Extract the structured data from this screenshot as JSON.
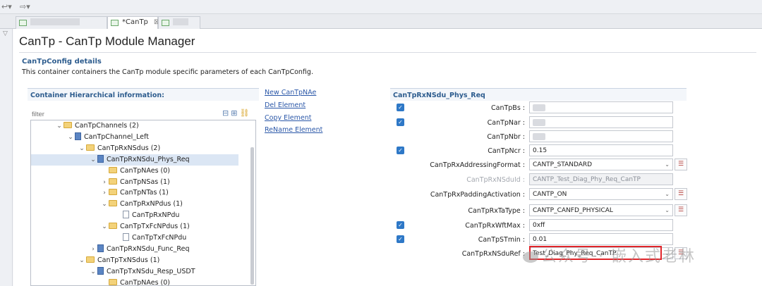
{
  "tabs": [
    {
      "label": "",
      "blurred": true
    },
    {
      "label": "*CanTp",
      "close": "⊠"
    },
    {
      "label": "",
      "blurred": true
    }
  ],
  "editor": {
    "title": "CanTp - CanTp Module Manager",
    "details_title": "CanTpConfig details",
    "details_desc": "This container containers the CanTp module specific parameters of each CanTpConfig."
  },
  "hierarchy": {
    "title": "Container Hierarchical information:",
    "filter_placeholder": "filter",
    "nodes": [
      {
        "label": "CanTpChannels (2)",
        "icon": "folder-icon",
        "twisty": "expanded",
        "depth": 0
      },
      {
        "label": "CanTpChannel_Left",
        "icon": "module-icon",
        "twisty": "expanded",
        "depth": 1
      },
      {
        "label": "CanTpRxNSdus (2)",
        "icon": "folder-icon",
        "twisty": "expanded",
        "depth": 2
      },
      {
        "label": "CanTpRxNSdu_Phys_Req",
        "icon": "module-icon",
        "twisty": "expanded",
        "depth": 3,
        "selected": true
      },
      {
        "label": "CanTpNAes (0)",
        "icon": "folder-icon",
        "twisty": "none",
        "depth": 4
      },
      {
        "label": "CanTpNSas (1)",
        "icon": "folder-icon",
        "twisty": "collapsed",
        "depth": 4
      },
      {
        "label": "CanTpNTas (1)",
        "icon": "folder-icon",
        "twisty": "collapsed",
        "depth": 4
      },
      {
        "label": "CanTpRxNPdus (1)",
        "icon": "folder-icon",
        "twisty": "expanded",
        "depth": 4
      },
      {
        "label": "CanTpRxNPdu",
        "icon": "document-icon",
        "twisty": "none",
        "depth": 5
      },
      {
        "label": "CanTpTxFcNPdus (1)",
        "icon": "folder-icon",
        "twisty": "expanded",
        "depth": 4
      },
      {
        "label": "CanTpTxFcNPdu",
        "icon": "document-icon",
        "twisty": "none",
        "depth": 5
      },
      {
        "label": "CanTpRxNSdu_Func_Req",
        "icon": "module-icon",
        "twisty": "collapsed",
        "depth": 3
      },
      {
        "label": "CanTpTxNSdus (1)",
        "icon": "folder-icon",
        "twisty": "expanded",
        "depth": 2
      },
      {
        "label": "CanTpTxNSdu_Resp_USDT",
        "icon": "module-icon",
        "twisty": "expanded",
        "depth": 3
      },
      {
        "label": "CanTpNAes (0)",
        "icon": "folder-icon",
        "twisty": "none",
        "depth": 4
      }
    ]
  },
  "actions": [
    "New CanTpNAe",
    "Del Element",
    "Copy Element",
    "ReName Element"
  ],
  "properties": {
    "title": "CanTpRxNSdu_Phys_Req",
    "fields": [
      {
        "label": "CanTpBs :",
        "value": "",
        "checked": true,
        "blurred": true
      },
      {
        "label": "CanTpNar :",
        "value": "",
        "checked": true,
        "blurred": true
      },
      {
        "label": "CanTpNbr :",
        "value": "",
        "checked": false,
        "blurred": true
      },
      {
        "label": "CanTpNcr :",
        "value": "0.15",
        "checked": true
      },
      {
        "label": "CanTpRxAddressingFormat :",
        "value": "CANTP_STANDARD",
        "dropdown": true,
        "list": true
      },
      {
        "label": "CanTpRxNSduId :",
        "value": "CANTP_Test_Diag_Phy_Req_CanTP",
        "disabled": true
      },
      {
        "label": "CanTpRxPaddingActivation :",
        "value": "CANTP_ON",
        "dropdown": true,
        "list": true
      },
      {
        "label": "CanTpRxTaType :",
        "value": "CANTP_CANFD_PHYSICAL",
        "dropdown": true,
        "list": true
      },
      {
        "label": "CanTpRxWftMax :",
        "value": "0xff",
        "checked": true
      },
      {
        "label": "CanTpSTmin :",
        "value": "0.01",
        "checked": true
      },
      {
        "label": "CanTpRxNSduRef :",
        "value": "Test_Diag_Phy_Req_CanTP",
        "dropdown": true,
        "list": true,
        "highlighted": true
      }
    ]
  },
  "watermark": "公众号 · 嵌入式老林",
  "colors": {
    "accent": "#2d5c8e",
    "link": "#2a57a8",
    "highlight": "#e0252a",
    "checkbox": "#2e78c7"
  }
}
